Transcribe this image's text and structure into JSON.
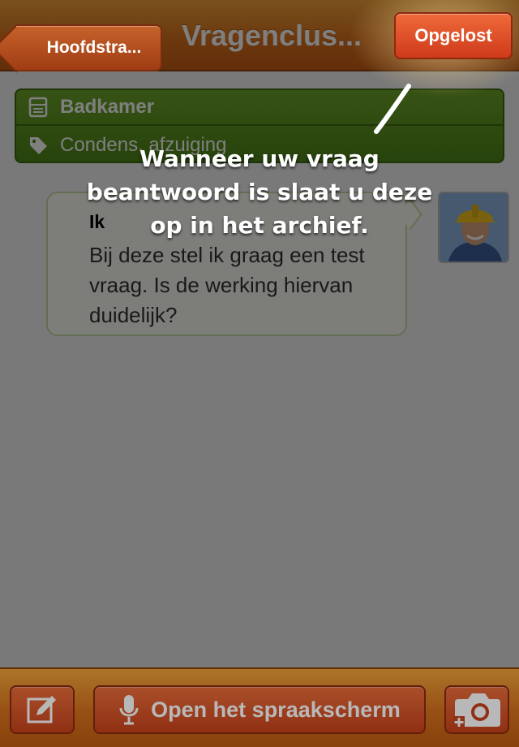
{
  "navbar": {
    "back_label": "Hoofdstra...",
    "title": "Vragenclus...",
    "solved_label": "Opgelost"
  },
  "category": {
    "name": "Badkamer",
    "tag": "Condens, afzuiging",
    "icon_room": "bathtub-icon",
    "icon_tag": "tag-icon"
  },
  "message": {
    "author": "Ik",
    "body": "Bij deze stel ik graag een test vraag. Is de werking hiervan duidelijk?"
  },
  "tutorial": {
    "text": "Wanneer uw vraag beantwoord is slaat u deze op in het archief."
  },
  "toolbar": {
    "speech_label": "Open het spraakscherm",
    "compose_icon": "compose-icon",
    "mic_icon": "microphone-icon",
    "camera_icon": "camera-add-icon"
  },
  "colors": {
    "nav_orange": "#d9711d",
    "button_red": "#cf3a1a",
    "category_green": "#5a9220"
  }
}
